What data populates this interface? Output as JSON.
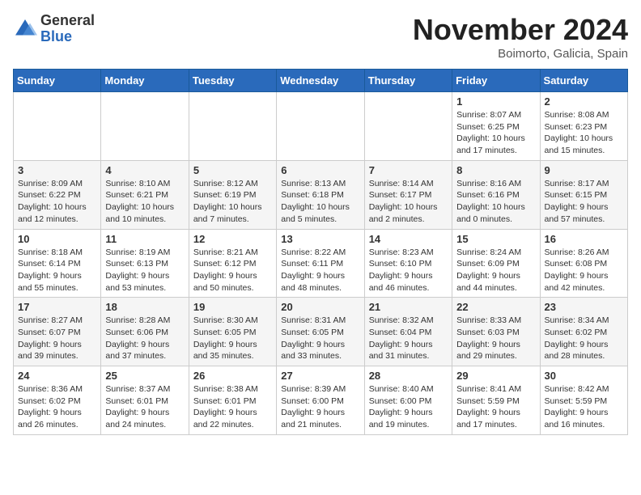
{
  "header": {
    "logo_general": "General",
    "logo_blue": "Blue",
    "month_title": "November 2024",
    "location": "Boimorto, Galicia, Spain"
  },
  "weekdays": [
    "Sunday",
    "Monday",
    "Tuesday",
    "Wednesday",
    "Thursday",
    "Friday",
    "Saturday"
  ],
  "weeks": [
    [
      {
        "day": "",
        "info": ""
      },
      {
        "day": "",
        "info": ""
      },
      {
        "day": "",
        "info": ""
      },
      {
        "day": "",
        "info": ""
      },
      {
        "day": "",
        "info": ""
      },
      {
        "day": "1",
        "info": "Sunrise: 8:07 AM\nSunset: 6:25 PM\nDaylight: 10 hours and 17 minutes."
      },
      {
        "day": "2",
        "info": "Sunrise: 8:08 AM\nSunset: 6:23 PM\nDaylight: 10 hours and 15 minutes."
      }
    ],
    [
      {
        "day": "3",
        "info": "Sunrise: 8:09 AM\nSunset: 6:22 PM\nDaylight: 10 hours and 12 minutes."
      },
      {
        "day": "4",
        "info": "Sunrise: 8:10 AM\nSunset: 6:21 PM\nDaylight: 10 hours and 10 minutes."
      },
      {
        "day": "5",
        "info": "Sunrise: 8:12 AM\nSunset: 6:19 PM\nDaylight: 10 hours and 7 minutes."
      },
      {
        "day": "6",
        "info": "Sunrise: 8:13 AM\nSunset: 6:18 PM\nDaylight: 10 hours and 5 minutes."
      },
      {
        "day": "7",
        "info": "Sunrise: 8:14 AM\nSunset: 6:17 PM\nDaylight: 10 hours and 2 minutes."
      },
      {
        "day": "8",
        "info": "Sunrise: 8:16 AM\nSunset: 6:16 PM\nDaylight: 10 hours and 0 minutes."
      },
      {
        "day": "9",
        "info": "Sunrise: 8:17 AM\nSunset: 6:15 PM\nDaylight: 9 hours and 57 minutes."
      }
    ],
    [
      {
        "day": "10",
        "info": "Sunrise: 8:18 AM\nSunset: 6:14 PM\nDaylight: 9 hours and 55 minutes."
      },
      {
        "day": "11",
        "info": "Sunrise: 8:19 AM\nSunset: 6:13 PM\nDaylight: 9 hours and 53 minutes."
      },
      {
        "day": "12",
        "info": "Sunrise: 8:21 AM\nSunset: 6:12 PM\nDaylight: 9 hours and 50 minutes."
      },
      {
        "day": "13",
        "info": "Sunrise: 8:22 AM\nSunset: 6:11 PM\nDaylight: 9 hours and 48 minutes."
      },
      {
        "day": "14",
        "info": "Sunrise: 8:23 AM\nSunset: 6:10 PM\nDaylight: 9 hours and 46 minutes."
      },
      {
        "day": "15",
        "info": "Sunrise: 8:24 AM\nSunset: 6:09 PM\nDaylight: 9 hours and 44 minutes."
      },
      {
        "day": "16",
        "info": "Sunrise: 8:26 AM\nSunset: 6:08 PM\nDaylight: 9 hours and 42 minutes."
      }
    ],
    [
      {
        "day": "17",
        "info": "Sunrise: 8:27 AM\nSunset: 6:07 PM\nDaylight: 9 hours and 39 minutes."
      },
      {
        "day": "18",
        "info": "Sunrise: 8:28 AM\nSunset: 6:06 PM\nDaylight: 9 hours and 37 minutes."
      },
      {
        "day": "19",
        "info": "Sunrise: 8:30 AM\nSunset: 6:05 PM\nDaylight: 9 hours and 35 minutes."
      },
      {
        "day": "20",
        "info": "Sunrise: 8:31 AM\nSunset: 6:05 PM\nDaylight: 9 hours and 33 minutes."
      },
      {
        "day": "21",
        "info": "Sunrise: 8:32 AM\nSunset: 6:04 PM\nDaylight: 9 hours and 31 minutes."
      },
      {
        "day": "22",
        "info": "Sunrise: 8:33 AM\nSunset: 6:03 PM\nDaylight: 9 hours and 29 minutes."
      },
      {
        "day": "23",
        "info": "Sunrise: 8:34 AM\nSunset: 6:02 PM\nDaylight: 9 hours and 28 minutes."
      }
    ],
    [
      {
        "day": "24",
        "info": "Sunrise: 8:36 AM\nSunset: 6:02 PM\nDaylight: 9 hours and 26 minutes."
      },
      {
        "day": "25",
        "info": "Sunrise: 8:37 AM\nSunset: 6:01 PM\nDaylight: 9 hours and 24 minutes."
      },
      {
        "day": "26",
        "info": "Sunrise: 8:38 AM\nSunset: 6:01 PM\nDaylight: 9 hours and 22 minutes."
      },
      {
        "day": "27",
        "info": "Sunrise: 8:39 AM\nSunset: 6:00 PM\nDaylight: 9 hours and 21 minutes."
      },
      {
        "day": "28",
        "info": "Sunrise: 8:40 AM\nSunset: 6:00 PM\nDaylight: 9 hours and 19 minutes."
      },
      {
        "day": "29",
        "info": "Sunrise: 8:41 AM\nSunset: 5:59 PM\nDaylight: 9 hours and 17 minutes."
      },
      {
        "day": "30",
        "info": "Sunrise: 8:42 AM\nSunset: 5:59 PM\nDaylight: 9 hours and 16 minutes."
      }
    ]
  ]
}
